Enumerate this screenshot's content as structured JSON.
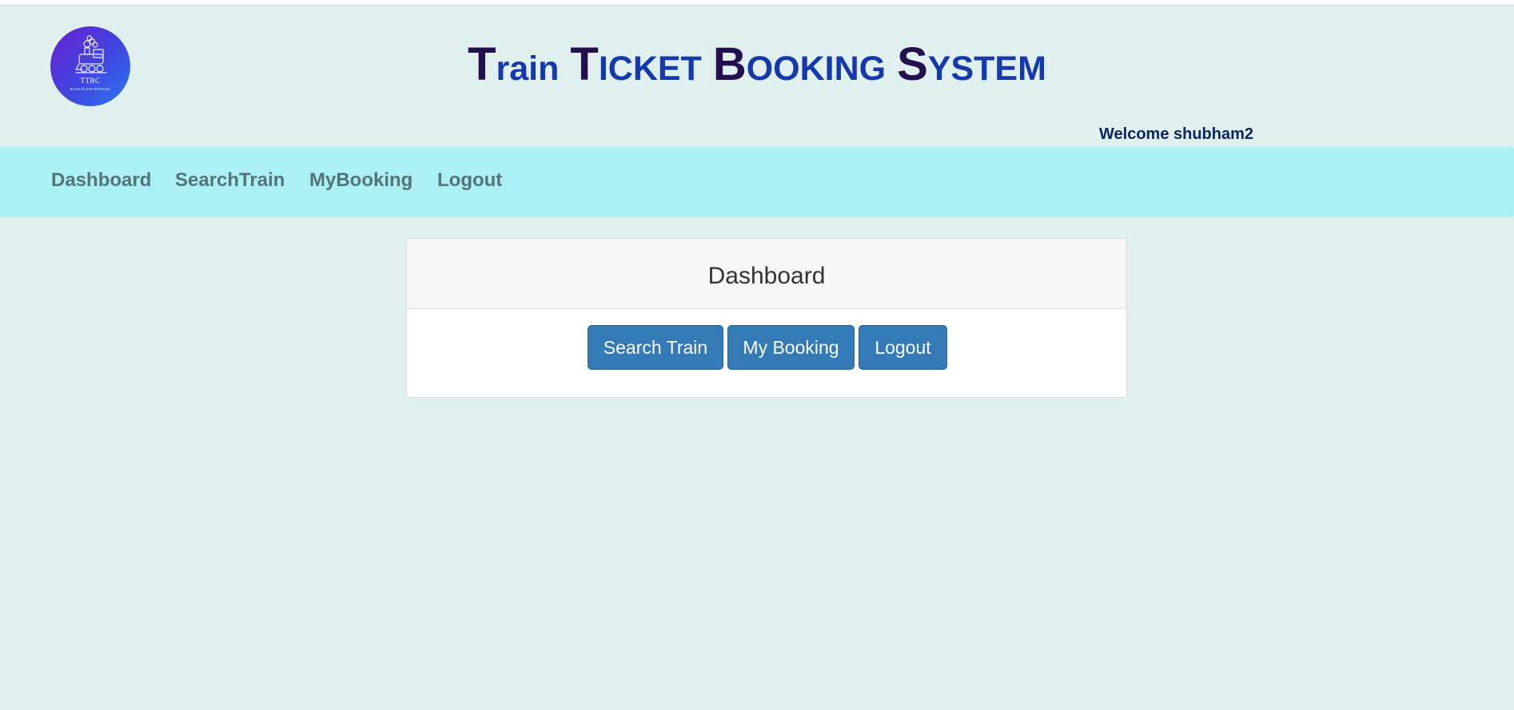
{
  "logo": {
    "title": "TTBC",
    "subtitle": "HASSLELESS BOOKING",
    "icon": "steam-train-icon"
  },
  "header": {
    "title_parts": [
      {
        "cap": "T",
        "rest": "rain"
      },
      {
        "cap": "T",
        "rest": "ICKET"
      },
      {
        "cap": "B",
        "rest": "OOKING"
      },
      {
        "cap": "S",
        "rest": "YSTEM"
      }
    ],
    "welcome": "Welcome shubham2"
  },
  "nav": {
    "items": [
      {
        "label": "Dashboard"
      },
      {
        "label": "SearchTrain"
      },
      {
        "label": "MyBooking"
      },
      {
        "label": "Logout"
      }
    ]
  },
  "panel": {
    "title": "Dashboard",
    "buttons": [
      {
        "label": "Search Train"
      },
      {
        "label": "My Booking"
      },
      {
        "label": "Logout"
      }
    ]
  },
  "colors": {
    "page_background": "#e0f0ef",
    "navbar_background": "#abf0f4",
    "title_capital": "#25104f",
    "title_text": "#1638ad",
    "button_primary": "#337ab7",
    "welcome_text": "#0c2660"
  }
}
